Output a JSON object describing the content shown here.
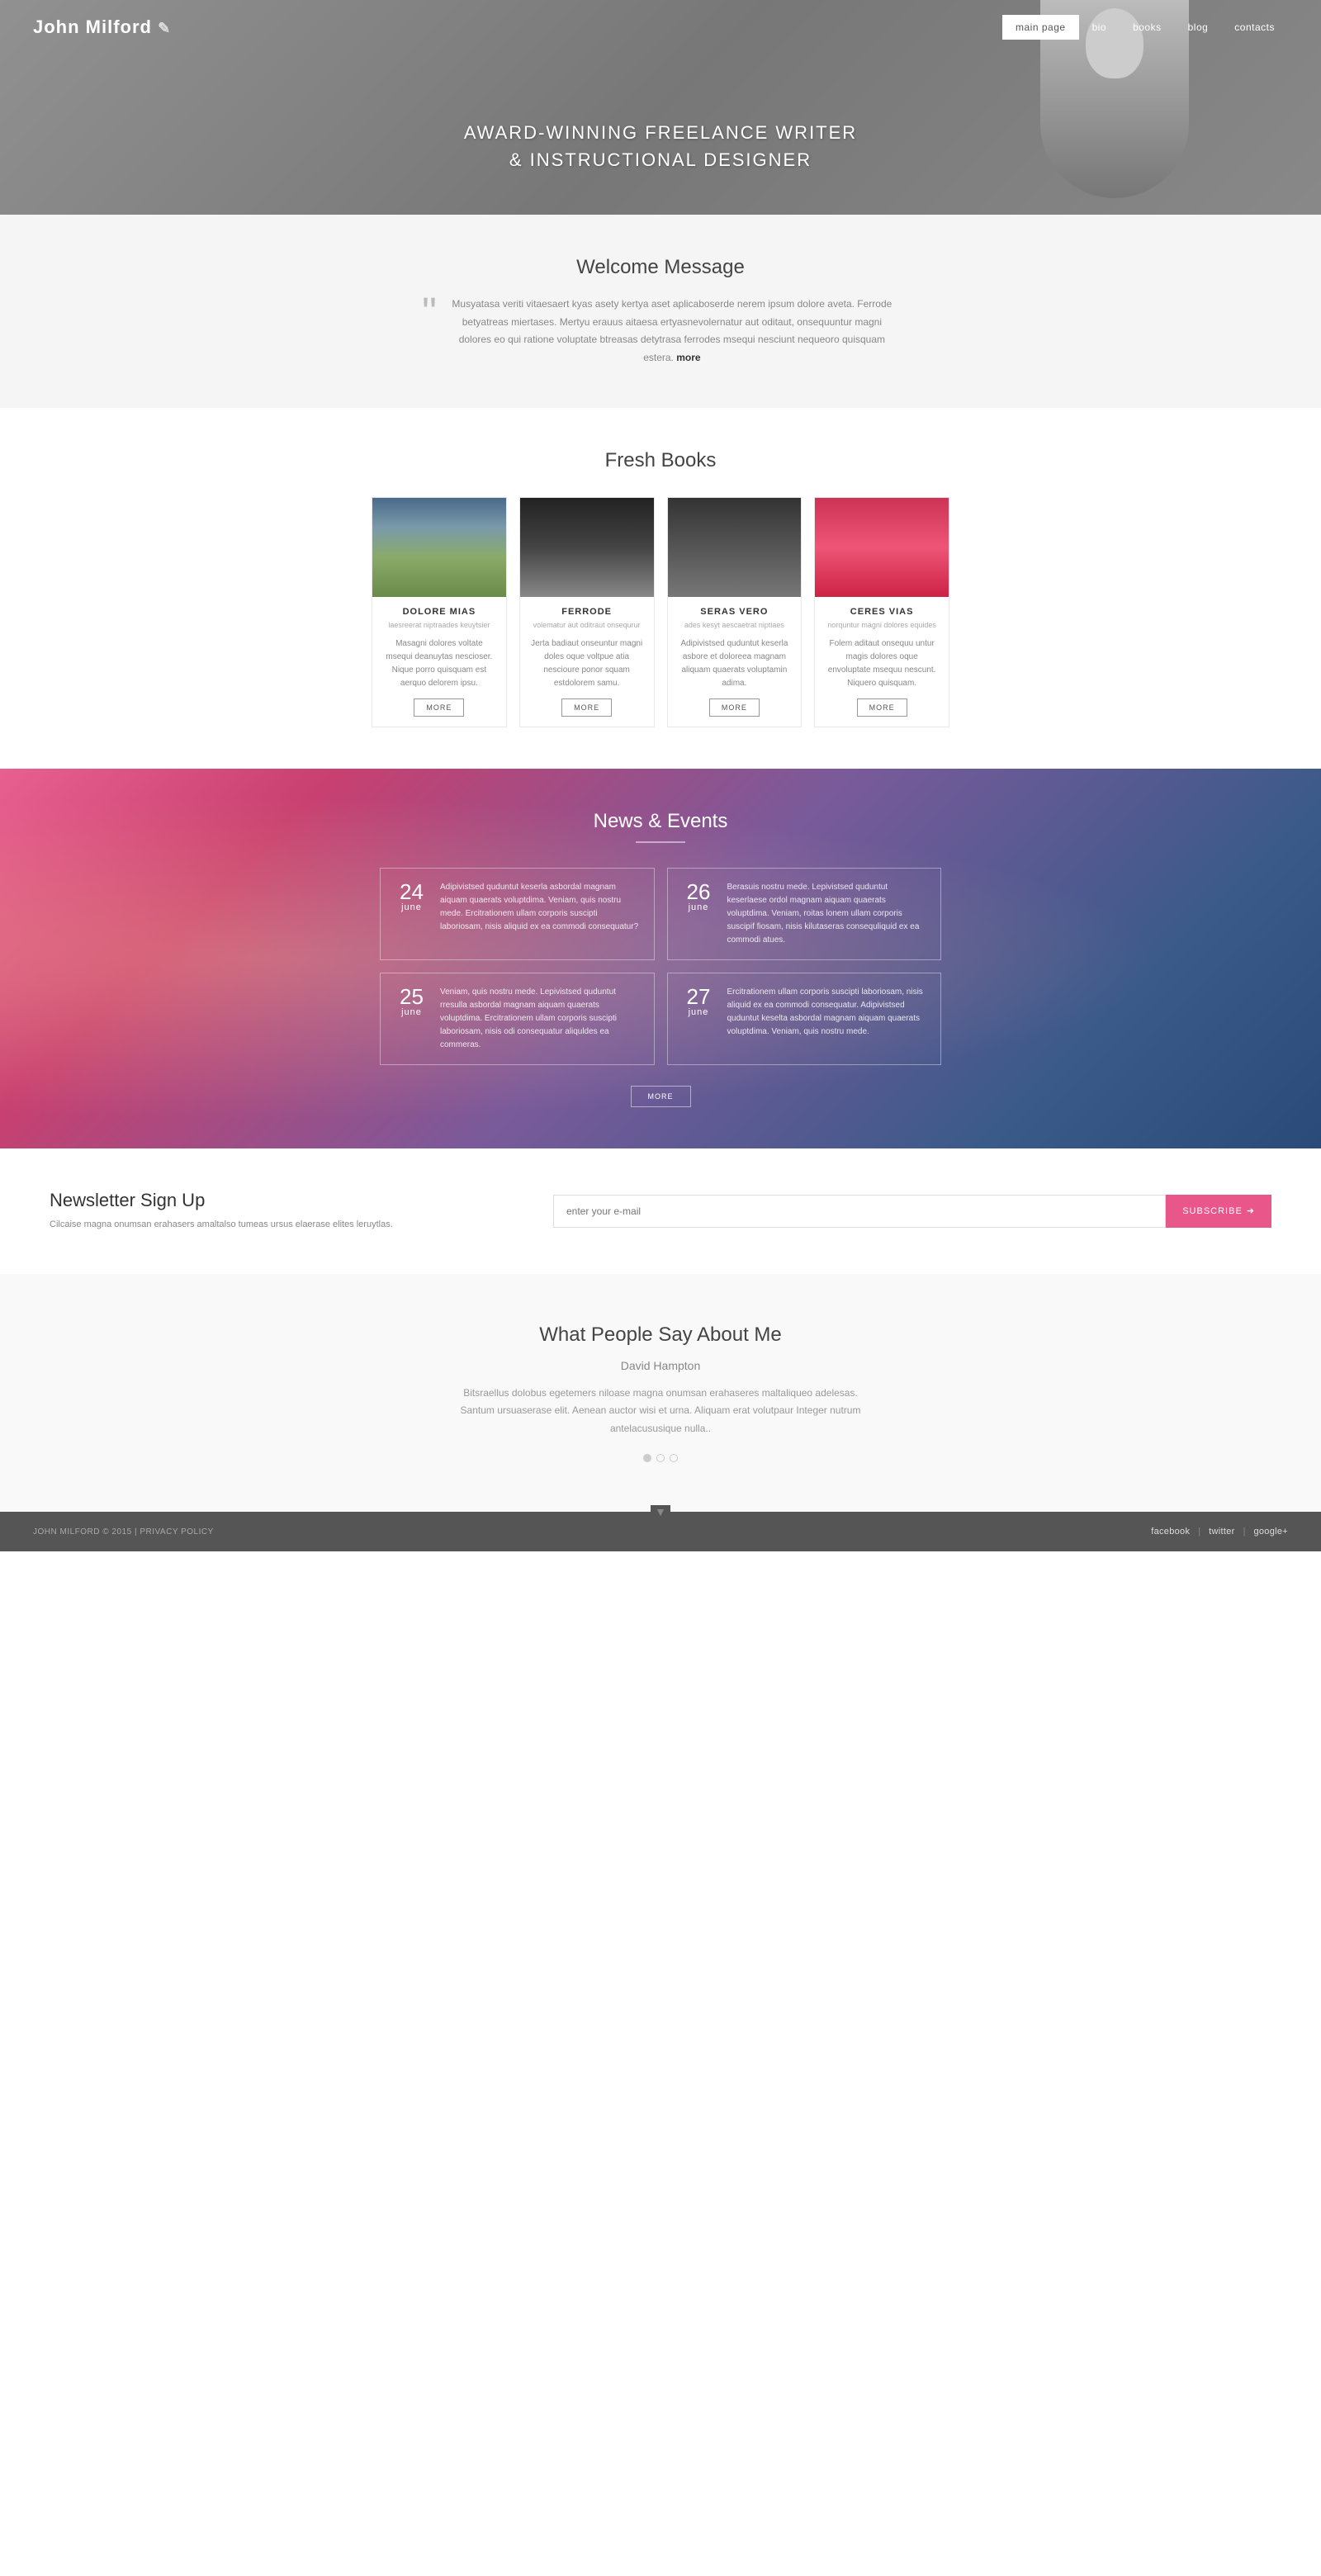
{
  "header": {
    "logo": "John Milford",
    "hero_line1": "AWARD-WINNING FREELANCE WRITER",
    "hero_line2": "& INSTRUCTIONAL DESIGNER"
  },
  "nav": {
    "items": [
      {
        "label": "main page",
        "active": true
      },
      {
        "label": "bio",
        "active": false
      },
      {
        "label": "books",
        "active": false
      },
      {
        "label": "blog",
        "active": false
      },
      {
        "label": "contacts",
        "active": false
      }
    ]
  },
  "welcome": {
    "title": "Welcome Message",
    "text": "Musyatasa veriti vitaesaert kyas asety kertya aset aplicaboserde nerem ipsum dolore aveta. Ferrode betyatreas miertases. Mertyu erauus aitaesa ertyasnevolernatur aut oditaut, onsequuntur magni dolores eo qui ratione voluptate btreasas detytrasa ferrodes msequi nesciunt nequeoro quisquam estera.",
    "more_label": "more"
  },
  "fresh_books": {
    "title": "Fresh Books",
    "books": [
      {
        "title": "DOLORE MIAS",
        "subtitle": "laesreerat niptraades keuytsier",
        "desc": "Masagni dolores voltate msequi deanuytas nescioser. Nique porro quisquam est aerquo delorem ipsu.",
        "btn": "MORE",
        "thumb_type": "road"
      },
      {
        "title": "FERRODE",
        "subtitle": "volematur aut oditraut onsequrur",
        "desc": "Jerta badiaut onseuntur magni doles oque voltpue atia nescioure ponor squam estdolorem samu.",
        "btn": "MORE",
        "thumb_type": "woman"
      },
      {
        "title": "SERAS VERO",
        "subtitle": "ades kesyt aescaetrat niptiaes",
        "desc": "Adipivistsed quduntut keserla asbore et doloreea magnam aliquam quaerats voluptamin adima.",
        "btn": "MORE",
        "thumb_type": "profile"
      },
      {
        "title": "CERES VIAS",
        "subtitle": "norquntur magni dolores equides",
        "desc": "Folem aditaut onsequu untur magis dolores oque envoluptate msequu nescunt. Niquero quisquam.",
        "btn": "MORE",
        "thumb_type": "lips"
      }
    ]
  },
  "news_events": {
    "title": "News & Events",
    "more_btn": "MORE",
    "items": [
      {
        "day": "24",
        "month": "june",
        "text": "Adipivistsed quduntut keserla asbordal magnam aiquam quaerats voluptdima. Veniam, quis nostru mede. Ercitrationem ullam corporis suscipti laboriosam, nisis aliquid ex ea commodi consequatur?"
      },
      {
        "day": "26",
        "month": "june",
        "text": "Berasuis nostru mede. Lepivistsed quduntut keserlaese ordol magnam aiquam quaerats voluptdima. Veniam, roitas lonem ullam corporis suscipif fiosam, nisis kilutaseras consequliquid ex ea commodi atues."
      },
      {
        "day": "25",
        "month": "june",
        "text": "Veniam, quis nostru mede. Lepivistsed quduntut rresulla asbordal magnam aiquam quaerats voluptdima. Ercitrationem ullam corporis suscipti laboriosam, nisis odi consequatur aliquldes ea commeras."
      },
      {
        "day": "27",
        "month": "june",
        "text": "Ercitrationem ullam corporis suscipti laboriosam, nisis aliquid ex ea commodi consequatur. Adipivistsed quduntut keselta asbordal magnam aiquam quaerats voluptdima. Veniam, quis nostru mede."
      }
    ]
  },
  "newsletter": {
    "title": "Newsletter Sign Up",
    "desc": "Cilcaise magna onumsan erahasers amaltalso tumeas ursus elaerase elites leruytlas.",
    "placeholder": "enter your e-mail",
    "btn": "SUBSCRIBE"
  },
  "testimonials": {
    "title": "What People Say About Me",
    "author": "David Hampton",
    "text": "Bitsraellus dolobus egetemers niloase magna onumsan erahaseres maltaliqueo adelesas. Santum ursuaserase elit. Aenean auctor wisi et urna. Aliquam erat volutpaur Integer nutrum antelacususique nulla..",
    "dots": [
      {
        "active": true
      },
      {
        "active": false
      },
      {
        "active": false
      }
    ]
  },
  "footer": {
    "copy": "JOHN MILFORD © 2015  |  PRIVACY POLICY",
    "links": [
      {
        "label": "facebook"
      },
      {
        "label": "twitter"
      },
      {
        "label": "google+"
      }
    ]
  }
}
